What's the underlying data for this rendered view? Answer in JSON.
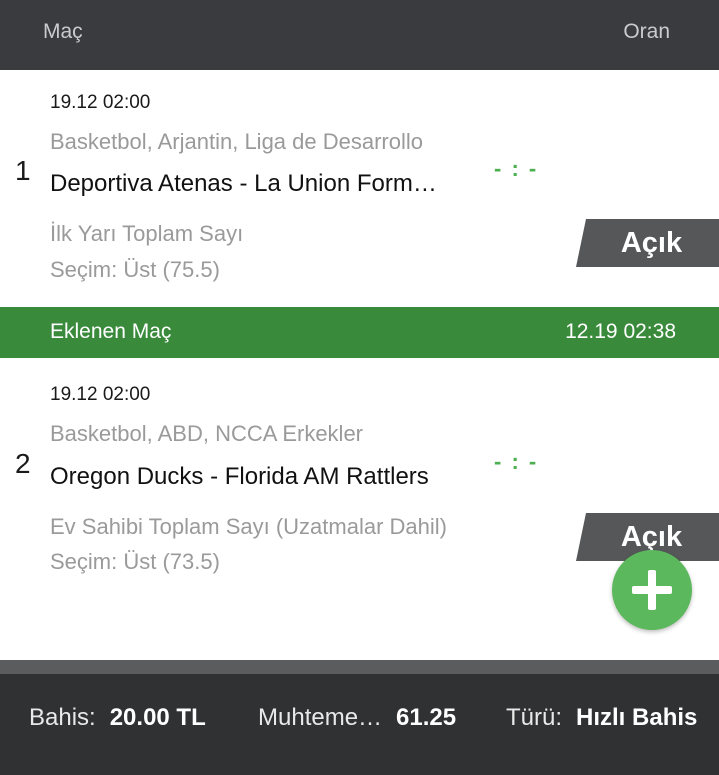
{
  "header": {
    "match_label": "Maç",
    "odds_label": "Oran"
  },
  "bets": [
    {
      "index": "1",
      "datetime": "19.12 02:00",
      "league": "Basketbol,  Arjantin,  Liga de Desarrollo",
      "match": "Deportiva Atenas - La Union Formosa",
      "score": "- : -",
      "market": "İlk Yarı Toplam Sayı",
      "selection": "Seçim: Üst (75.5)",
      "odds": "Açık"
    },
    {
      "index": "2",
      "datetime": "19.12 02:00",
      "league": "Basketbol,  ABD,  NCCA Erkekler",
      "match": "Oregon Ducks - Florida AM Rattlers",
      "score": "- : -",
      "market": "Ev Sahibi Toplam Sayı (Uzatmalar Dahil)",
      "selection": "Seçim: Üst (73.5)",
      "odds": "Açık"
    }
  ],
  "added_bar": {
    "label": "Eklenen Maç",
    "timestamp": "12.19 02:38"
  },
  "fab": {
    "icon": "plus-icon"
  },
  "footer": {
    "stake_label": "Bahis:",
    "stake_value": "20.00 TL",
    "potential_label": "Muhteme…",
    "potential_value": "61.25",
    "type_label": "Türü:",
    "type_value": "Hızlı Bahis"
  },
  "colors": {
    "header_bg": "#393b3e",
    "accent_green": "#3a8a3c",
    "fab_green": "#5cb85c",
    "odds_bg": "#555759",
    "footer_bg": "#2f3133"
  }
}
